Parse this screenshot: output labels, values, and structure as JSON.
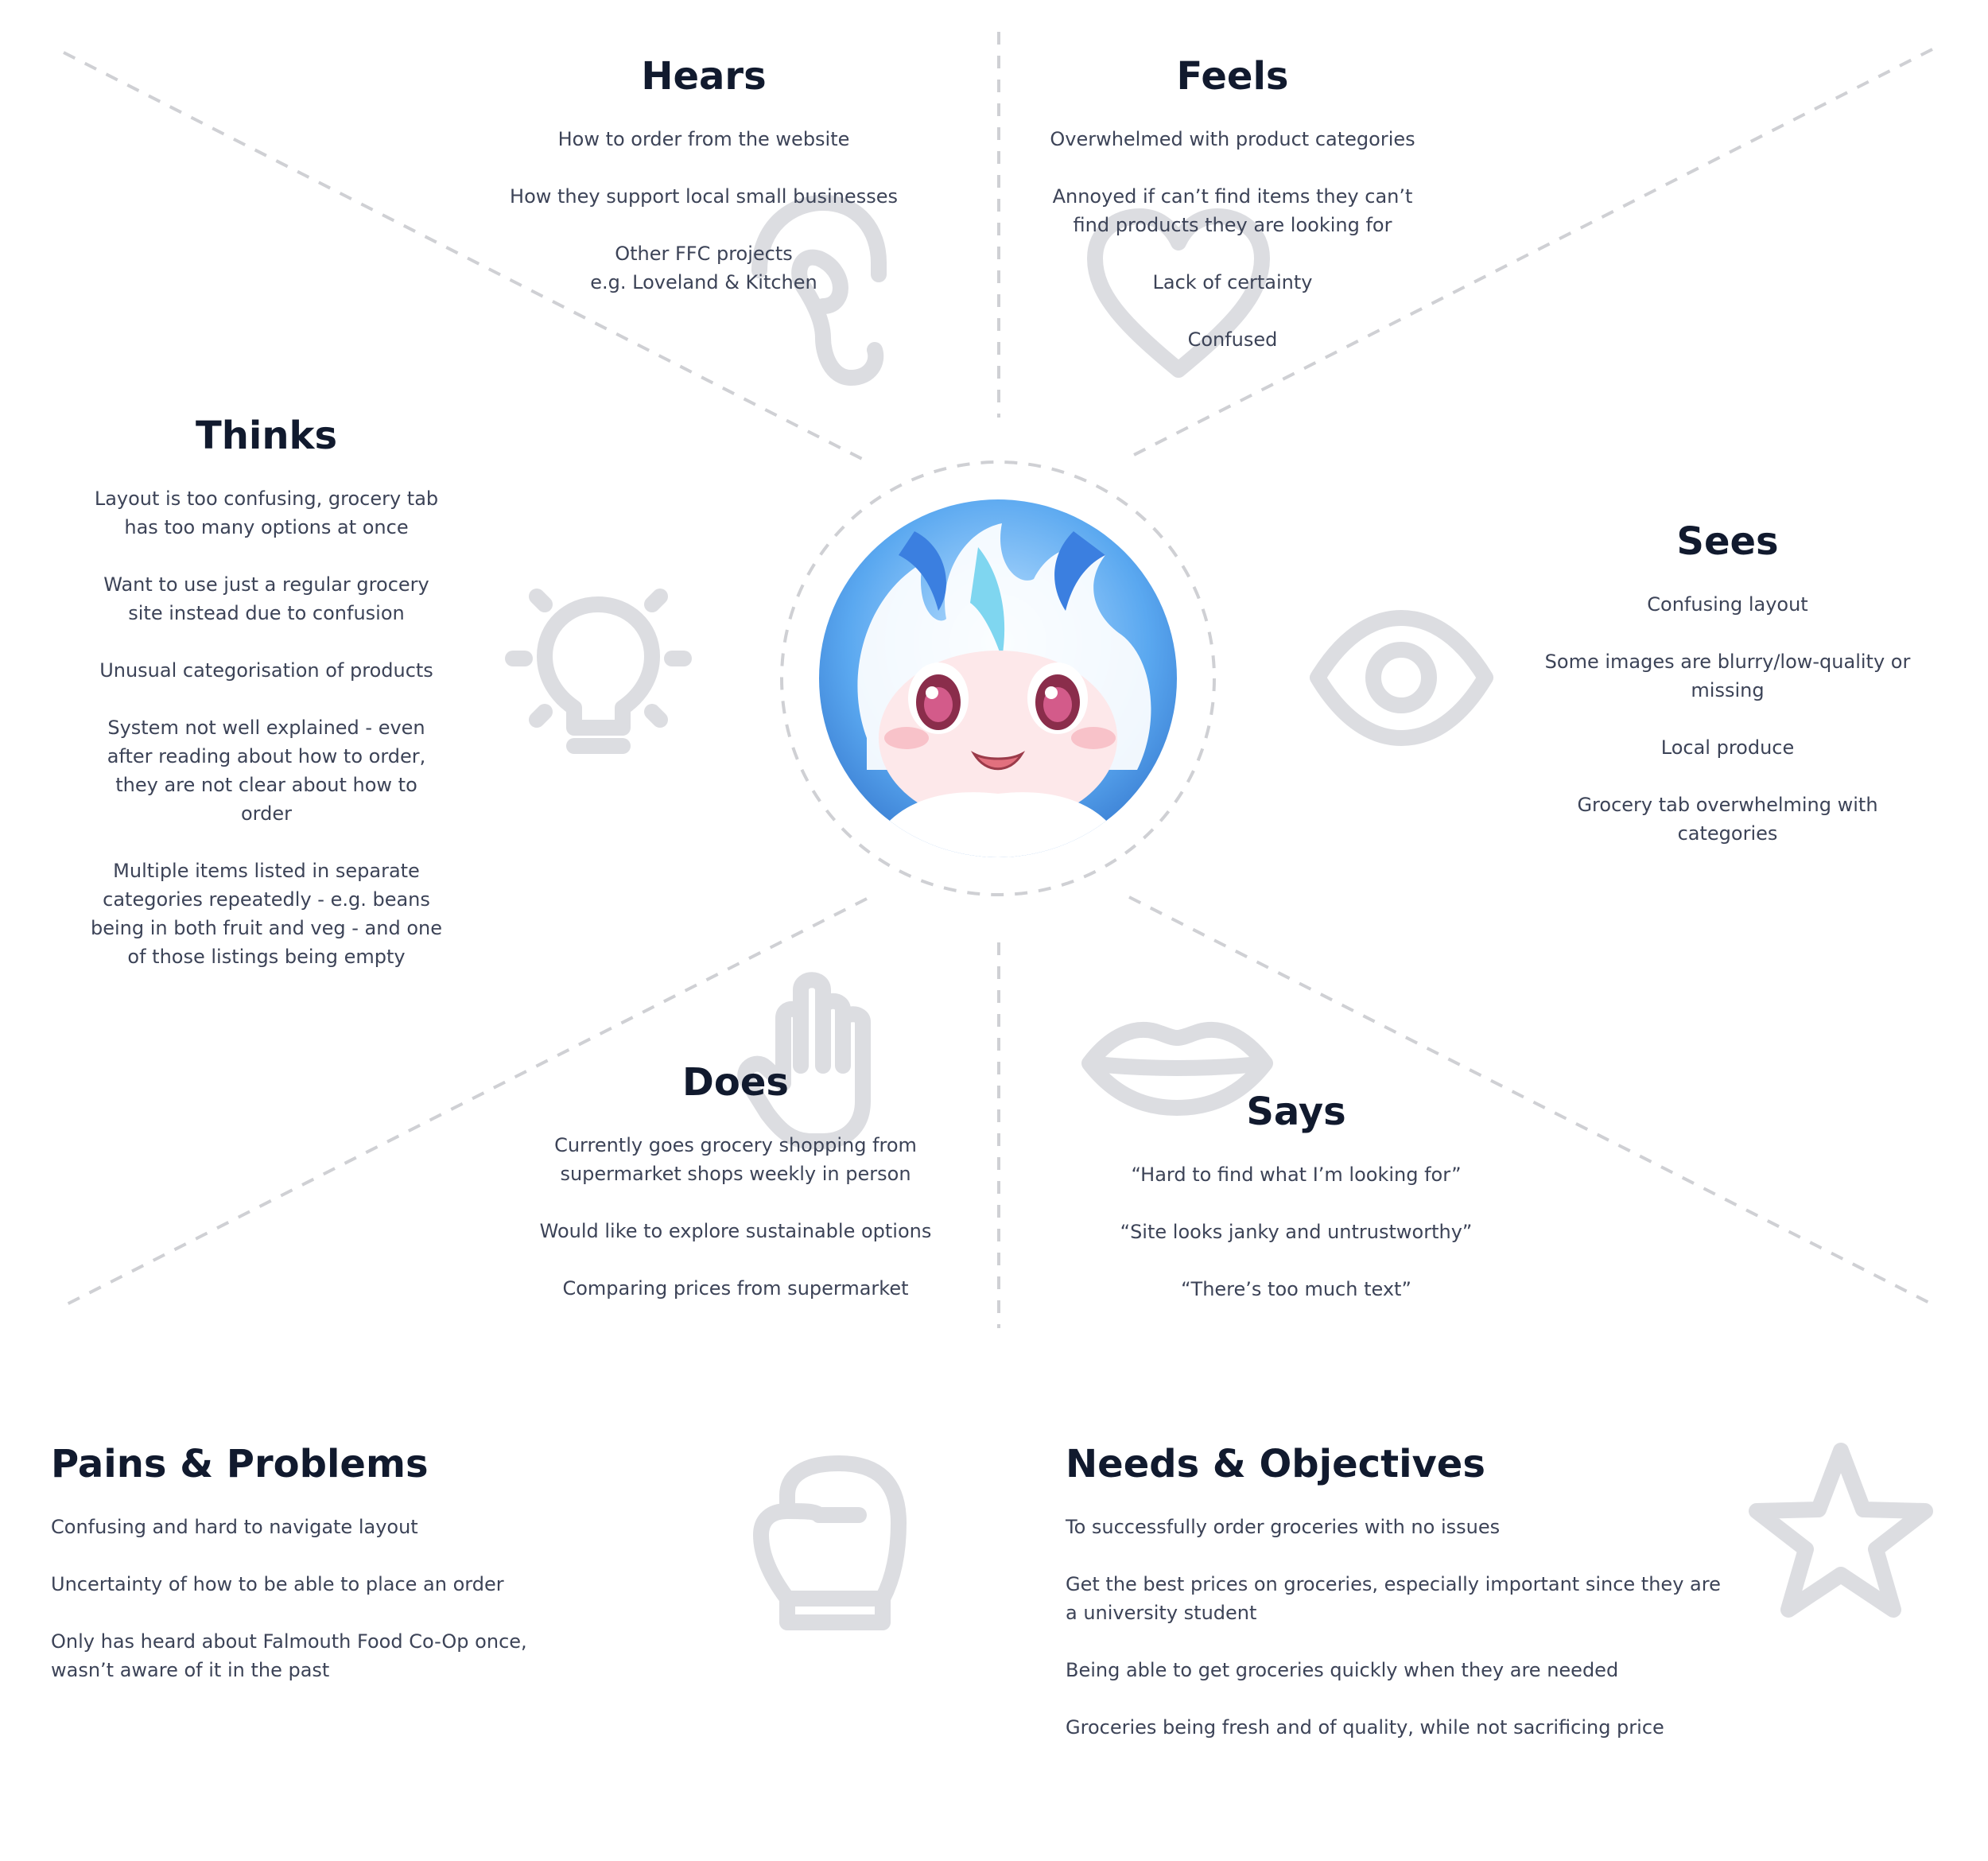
{
  "hears": {
    "title": "Hears",
    "items": [
      "How to order from the website",
      "How they support local small businesses",
      "Other FFC projects\ne.g. Loveland & Kitchen"
    ]
  },
  "feels": {
    "title": "Feels",
    "items": [
      "Overwhelmed with product categories",
      "Annoyed if can’t find items they can’t find products they are looking for",
      "Lack of certainty",
      "Confused"
    ]
  },
  "thinks": {
    "title": "Thinks",
    "items": [
      "Layout is too confusing, grocery tab has too many options at once",
      "Want to use just a regular grocery site instead due to confusion",
      "Unusual categorisation of products",
      "System not well explained - even after reading about how to order, they are not clear about how to order",
      "Multiple items listed in separate categories repeatedly - e.g. beans being in both fruit and veg - and one of those listings being empty"
    ]
  },
  "sees": {
    "title": "Sees",
    "items": [
      "Confusing layout",
      "Some images are blurry/low-quality or missing",
      "Local produce",
      "Grocery tab overwhelming with categories"
    ]
  },
  "does": {
    "title": "Does",
    "items": [
      "Currently goes grocery shopping from supermarket shops weekly in person",
      "Would like to explore sustainable options",
      "Comparing prices from supermarket"
    ]
  },
  "says": {
    "title": "Says",
    "items": [
      "“Hard to find what I’m looking for”",
      "“Site looks janky and untrustworthy”",
      "“There’s too much text”"
    ]
  },
  "pains": {
    "title": "Pains & Problems",
    "items": [
      "Confusing and hard to navigate layout",
      "Uncertainty of how to be able to place an order",
      "Only has heard about Falmouth Food Co-Op once, wasn’t aware of it in the past"
    ]
  },
  "needs": {
    "title": "Needs & Objectives",
    "items": [
      "To successfully order groceries with no issues",
      "Get the best prices on groceries, especially important since they are a university student",
      "Being able to get groceries quickly when they are needed",
      "Groceries being fresh and of quality, while not sacrificing price"
    ]
  },
  "icons": [
    "ear-icon",
    "heart-icon",
    "lightbulb-icon",
    "eye-icon",
    "hand-icon",
    "lips-icon",
    "boxing-glove-icon",
    "star-icon"
  ],
  "colors": {
    "heading": "#111a2e",
    "text": "#3c4357",
    "icon": "#dcdde1",
    "dashed_line": "#cfd0d4"
  }
}
